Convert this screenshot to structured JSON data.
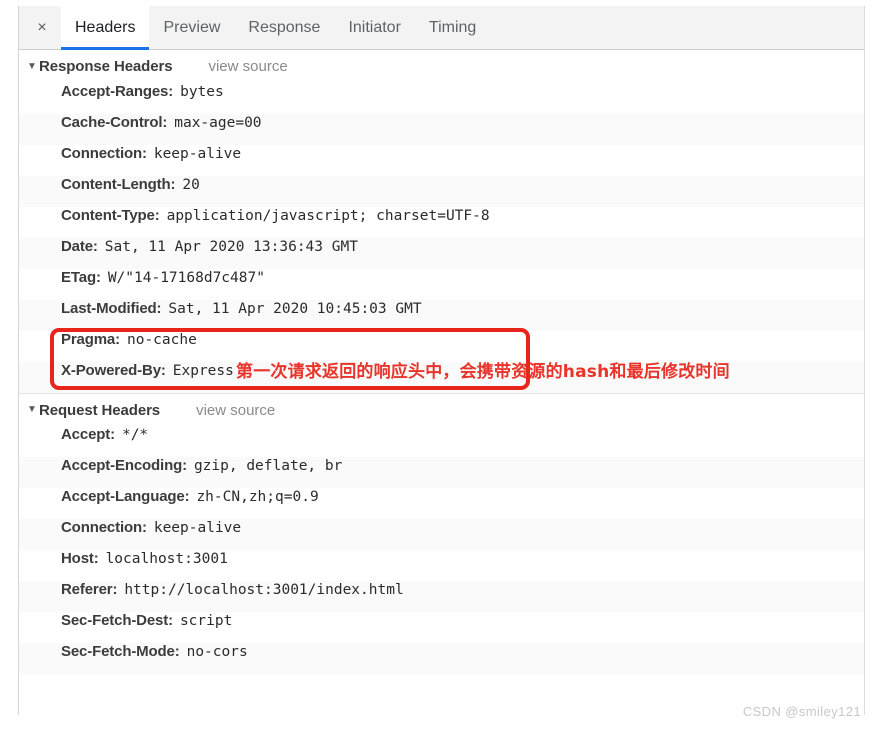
{
  "panel": {
    "close_label": "×",
    "tabs": [
      {
        "label": "Headers",
        "active": true
      },
      {
        "label": "Preview",
        "active": false
      },
      {
        "label": "Response",
        "active": false
      },
      {
        "label": "Initiator",
        "active": false
      },
      {
        "label": "Timing",
        "active": false
      }
    ]
  },
  "sections": [
    {
      "title": "Response Headers",
      "view_source": "view source",
      "twisty": "▼",
      "rows": [
        {
          "name": "Accept-Ranges:",
          "value": "bytes"
        },
        {
          "name": "Cache-Control:",
          "value": "max-age=00"
        },
        {
          "name": "Connection:",
          "value": "keep-alive"
        },
        {
          "name": "Content-Length:",
          "value": "20"
        },
        {
          "name": "Content-Type:",
          "value": "application/javascript; charset=UTF-8"
        },
        {
          "name": "Date:",
          "value": "Sat, 11 Apr 2020 13:36:43 GMT"
        },
        {
          "name": "ETag:",
          "value": "W/\"14-17168d7c487\""
        },
        {
          "name": "Last-Modified:",
          "value": "Sat, 11 Apr 2020 10:45:03 GMT"
        },
        {
          "name": "Pragma:",
          "value": "no-cache"
        },
        {
          "name": "X-Powered-By:",
          "value": "Express"
        }
      ]
    },
    {
      "title": "Request Headers",
      "view_source": "view source",
      "twisty": "▼",
      "rows": [
        {
          "name": "Accept:",
          "value": "*/*"
        },
        {
          "name": "Accept-Encoding:",
          "value": "gzip, deflate, br"
        },
        {
          "name": "Accept-Language:",
          "value": "zh-CN,zh;q=0.9"
        },
        {
          "name": "Connection:",
          "value": "keep-alive"
        },
        {
          "name": "Host:",
          "value": "localhost:3001"
        },
        {
          "name": "Referer:",
          "value": "http://localhost:3001/index.html"
        },
        {
          "name": "Sec-Fetch-Dest:",
          "value": "script"
        },
        {
          "name": "Sec-Fetch-Mode:",
          "value": "no-cors"
        }
      ]
    }
  ],
  "annotations": {
    "note_text": "第一次请求返回的响应头中，会携带资源的hash和最后修改时间",
    "note_color": "#e8342a",
    "highlight_color": "#e8251b"
  },
  "watermark": {
    "text": "CSDN @smiley121"
  }
}
